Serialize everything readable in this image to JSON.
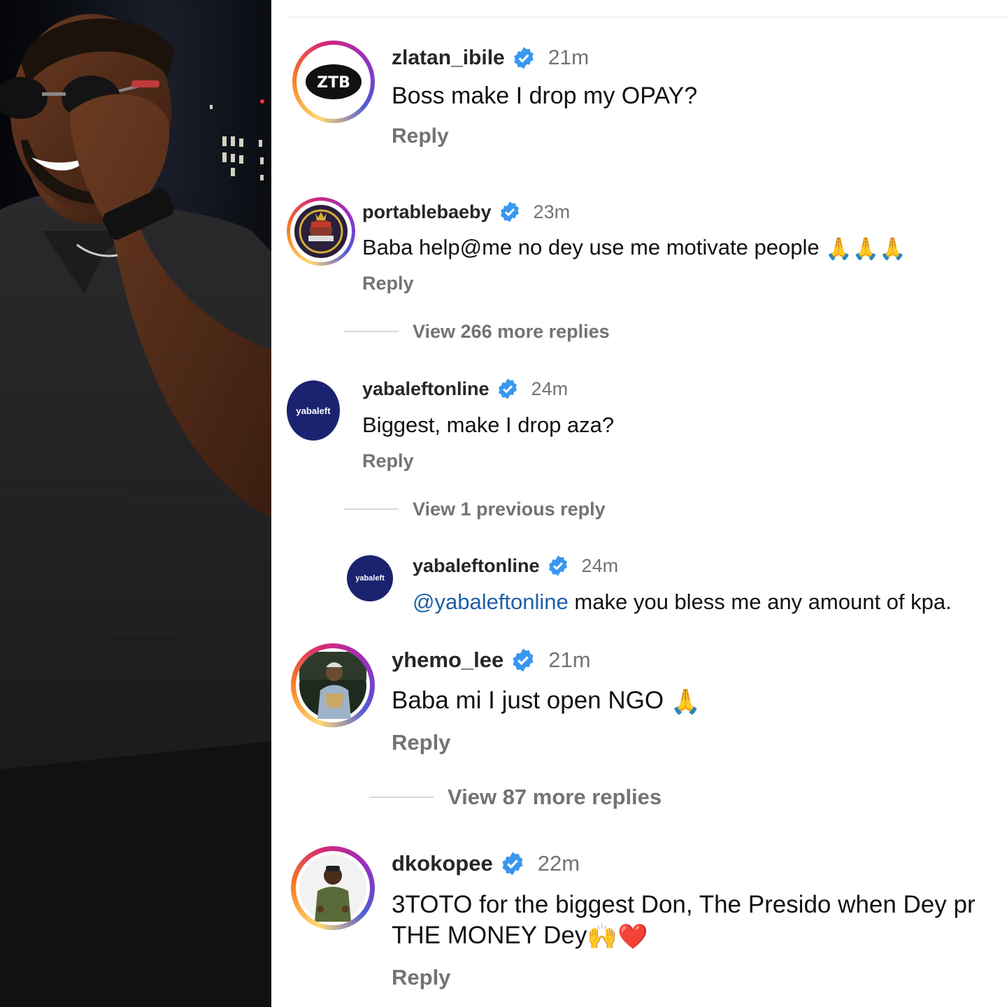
{
  "comments": [
    {
      "username": "zlatan_ibile",
      "time": "21m",
      "text": "Boss make I drop my OPAY?",
      "reply_label": "Reply",
      "avatar_icon": "zlatan-logo-icon"
    },
    {
      "username": "portablebaeby",
      "time": "23m",
      "text": "Baba help@me no dey use me motivate people",
      "emoji": "🙏🙏🙏",
      "reply_label": "Reply",
      "avatar_icon": "portable-logo-icon",
      "view_more": "View 266 more replies"
    },
    {
      "username": "yabaleftonline",
      "time": "24m",
      "text": "Biggest, make I drop aza?",
      "reply_label": "Reply",
      "avatar_icon": "yabaleft-logo-icon",
      "view_more": "View 1 previous reply",
      "avatar_text": "yabaleft"
    },
    {
      "username": "yabaleftonline",
      "time": "24m",
      "mention": "@yabaleftonline",
      "text": " make you bless me any amount of kpa.",
      "avatar_icon": "yabaleft-logo-icon",
      "avatar_text": "yabaleft"
    },
    {
      "username": "yhemo_lee",
      "time": "21m",
      "text": "Baba mi I just open NGO",
      "emoji": "🙏",
      "reply_label": "Reply",
      "avatar_icon": "person-photo-icon",
      "view_more": "View 87 more replies"
    },
    {
      "username": "dkokopee",
      "time": "22m",
      "text_line1": "3TOTO for the biggest Don, The Presido when Dey pr",
      "text_line2": "THE MONEY Dey",
      "emoji": "🙌❤️",
      "reply_label": "Reply",
      "avatar_icon": "person-photo-icon"
    }
  ],
  "colors": {
    "verified_blue": "#3897f0",
    "muted": "#737373",
    "yabaleft_navy": "#1b2370"
  }
}
